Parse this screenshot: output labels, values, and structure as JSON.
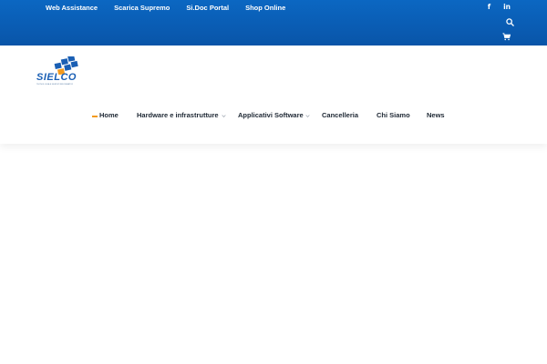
{
  "topbar": {
    "links": [
      "Web Assistance",
      "Scarica Supremo",
      "Si.Doc Portal",
      "Shop Online"
    ],
    "social": [
      "f",
      "in"
    ],
    "colors": {
      "bar": "#0a5cb3",
      "accent": "#f39a1e"
    }
  },
  "logo": {
    "word": "SIELCO",
    "tagline": "TECNOLOGIA E SERVIZI INFORMATICI"
  },
  "nav": {
    "items": [
      {
        "label": "Home",
        "active": true
      },
      {
        "label": "Hardware e infrastrutture",
        "dropdown": true
      },
      {
        "label": "Applicativi Software",
        "dropdown": true
      },
      {
        "label": "Cancelleria"
      },
      {
        "label": "Chi Siamo"
      },
      {
        "label": "News"
      }
    ]
  },
  "icons": {
    "search": "search-icon",
    "cart": "cart-icon",
    "facebook": "facebook-icon",
    "linkedin": "linkedin-icon"
  }
}
